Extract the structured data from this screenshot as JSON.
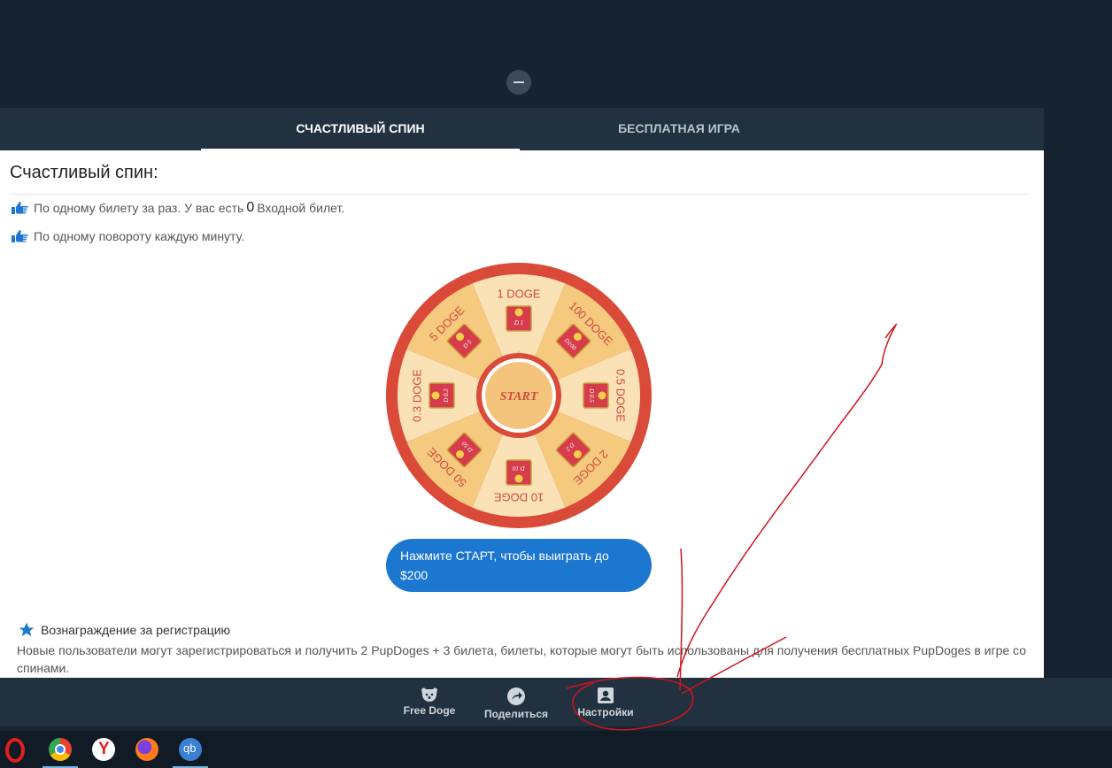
{
  "tabs": [
    {
      "label": "СЧАСТЛИВЫЙ СПИН",
      "active": true
    },
    {
      "label": "БЕСПЛАТНАЯ ИГРА",
      "active": false
    }
  ],
  "page": {
    "title": "Счастливый спин:",
    "rule1_prefix": "По одному билету за раз. У вас есть",
    "ticket_count": "0",
    "rule1_suffix": "Входной билет.",
    "rule2": "По одному повороту каждую минуту."
  },
  "wheel": {
    "start_label": "START",
    "segments": [
      {
        "label": "1 DOGE",
        "coin": "D 1"
      },
      {
        "label": "100 DOGE",
        "coin": "D100"
      },
      {
        "label": "0.5 DOGE",
        "coin": "D 0.5"
      },
      {
        "label": "2 DOGE",
        "coin": "D 2"
      },
      {
        "label": "10 DOGE",
        "coin": "D 10"
      },
      {
        "label": "50 DOGE",
        "coin": "D 50"
      },
      {
        "label": "0.3 DOGE",
        "coin": "D 0.3"
      },
      {
        "label": "5 DOGE",
        "coin": "D 5"
      }
    ],
    "colors": {
      "rim": "#d94a38",
      "light": "#fbe1b6",
      "dark": "#f5c97e",
      "text": "#d14b3c"
    }
  },
  "cta": {
    "label": "Нажмите СТАРТ, чтобы выиграть до $200"
  },
  "reward": {
    "heading": "Вознаграждение за регистрацию",
    "text": "Новые пользователи могут зарегистрироваться и получить 2 PupDoges + 3 билета, билеты, которые могут быть использованы для получения бесплатных PupDoges в игре со спинами."
  },
  "bottom_nav": [
    {
      "label": "Free Doge",
      "icon": "dog-icon"
    },
    {
      "label": "Поделиться",
      "icon": "share-icon"
    },
    {
      "label": "Настройки",
      "icon": "account-box-icon"
    }
  ],
  "taskbar": {
    "apps": [
      {
        "name": "opera-icon",
        "color": "#e0201b"
      },
      {
        "name": "chrome-icon",
        "color": "#4caf50"
      },
      {
        "name": "yandex-icon",
        "color": "#ffffff"
      },
      {
        "name": "firefox-icon",
        "color": "#ff7a1a"
      },
      {
        "name": "qbittorrent-icon",
        "color": "#3a7fd1",
        "text": "qb"
      }
    ]
  },
  "accent_colors": {
    "primary": "#1c77d1",
    "header": "#22313f",
    "background": "#172331",
    "annotation": "#d0141c"
  }
}
